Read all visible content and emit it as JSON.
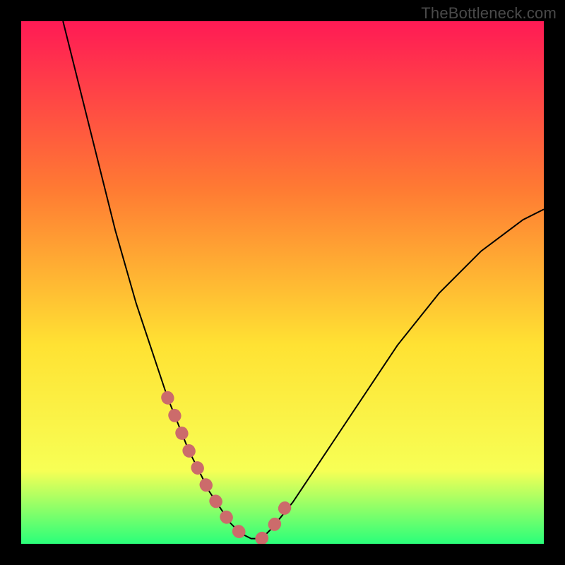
{
  "watermark": "TheBottleneck.com",
  "chart_data": {
    "type": "line",
    "title": "",
    "xlabel": "",
    "ylabel": "",
    "xlim": [
      0,
      100
    ],
    "ylim": [
      0,
      100
    ],
    "grid": false,
    "legend": false,
    "background_gradient": {
      "top": "#ff1a55",
      "mid1": "#ff7a33",
      "mid2": "#ffe233",
      "mid3": "#f7ff55",
      "bottom": "#2aff7a"
    },
    "annotations": [
      {
        "text": "TheBottleneck.com",
        "position": "top-right",
        "color": "#4a4a4a"
      }
    ],
    "series": [
      {
        "name": "curve",
        "color": "#000000",
        "x": [
          8,
          10,
          12,
          14,
          16,
          18,
          20,
          22,
          24,
          26,
          28,
          30,
          32,
          34,
          36,
          38,
          40,
          42,
          44,
          46,
          48,
          52,
          56,
          60,
          64,
          68,
          72,
          76,
          80,
          84,
          88,
          92,
          96,
          100
        ],
        "y": [
          100,
          92,
          84,
          76,
          68,
          60,
          53,
          46,
          40,
          34,
          28,
          23,
          18,
          14,
          10,
          7,
          4,
          2,
          1,
          1,
          3,
          8,
          14,
          20,
          26,
          32,
          38,
          43,
          48,
          52,
          56,
          59,
          62,
          64
        ]
      }
    ],
    "marker_segments": [
      {
        "name": "left-marker-run",
        "color": "#cc6b6b",
        "x": [
          28,
          30,
          32,
          34,
          36,
          38,
          40,
          42,
          44
        ],
        "y": [
          28,
          23,
          18,
          14,
          10,
          7,
          4,
          2,
          1
        ]
      },
      {
        "name": "right-marker-run",
        "color": "#cc6b6b",
        "x": [
          46,
          48,
          50,
          52
        ],
        "y": [
          1,
          3,
          6,
          10
        ]
      }
    ]
  }
}
